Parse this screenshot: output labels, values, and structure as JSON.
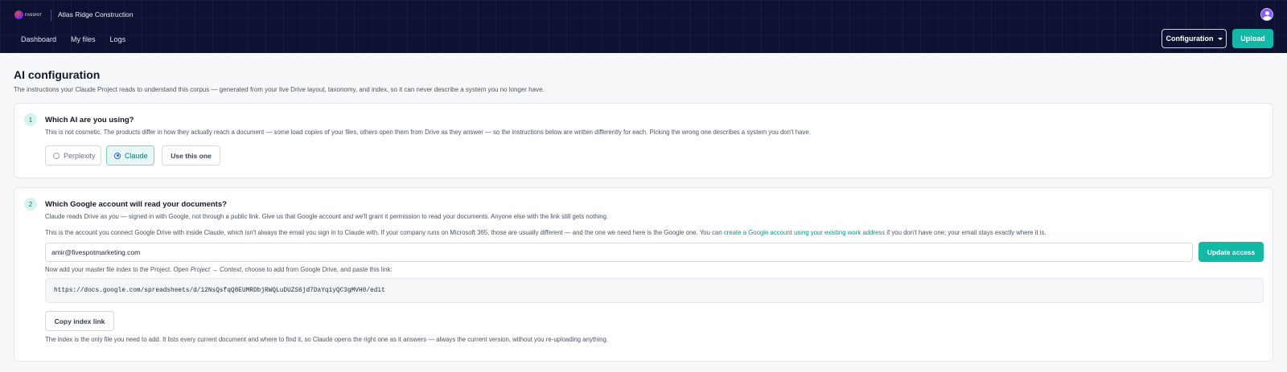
{
  "header": {
    "logo_text": "FIVESPOT",
    "org_name": "Atlas Ridge Construction",
    "nav": [
      "Dashboard",
      "My files",
      "Logs"
    ],
    "configuration_label": "Configuration",
    "upload_label": "Upload"
  },
  "page": {
    "title": "AI configuration",
    "subtitle": "The instructions your Claude Project reads to understand this corpus — generated from your live Drive layout, taxonomy, and index, so it can never describe a system you no longer have."
  },
  "step1": {
    "number": "1",
    "title": "Which AI are you using?",
    "description": "This is not cosmetic. The products differ in how they actually reach a document — some load copies of your files, others open them from Drive as they answer — so the instructions below are written differently for each. Picking the wrong one describes a system you don't have.",
    "options": [
      {
        "label": "Perplexity",
        "selected": false
      },
      {
        "label": "Claude",
        "selected": true
      }
    ],
    "use_button": "Use this one"
  },
  "step2": {
    "number": "2",
    "title": "Which Google account will read your documents?",
    "desc1_before": "Claude reads Drive as ",
    "desc1_em": "you",
    "desc1_after": " — signed in with Google, not through a public link. Give us that Google account and we'll grant it permission to read your documents. Anyone else with the link still gets nothing.",
    "desc2_before": "This is the account you connect Google Drive with inside Claude, which isn't always the email you sign in to Claude with. If your company runs on Microsoft 365, those are usually different — and the one we need here is the Google one. You can ",
    "desc2_link": "create a Google account using your existing work address",
    "desc2_after": " if you don't have one; your email stays exactly where it is.",
    "email_value": "amir@fivespotmarketing.com",
    "update_button": "Update access",
    "index_before": "Now add your master file index to the Project. Open ",
    "index_em": "Project → Context",
    "index_after": ", choose to add from Google Drive, and paste this link:",
    "index_link": "https://docs.google.com/spreadsheets/d/12NsQsfqQ8EUMRDbjRWQLuDUZS6jd7DaYq1yQC3gMVH0/edit",
    "copy_button": "Copy index link",
    "footer": "The index is the only file you need to add. It lists every current document and where to find it, so Claude opens the right one as it answers — always the current version, without you re-uploading anything."
  },
  "colors": {
    "header_bg": "#0d1233",
    "accent": "#14b8a6",
    "link": "#0d9488"
  }
}
